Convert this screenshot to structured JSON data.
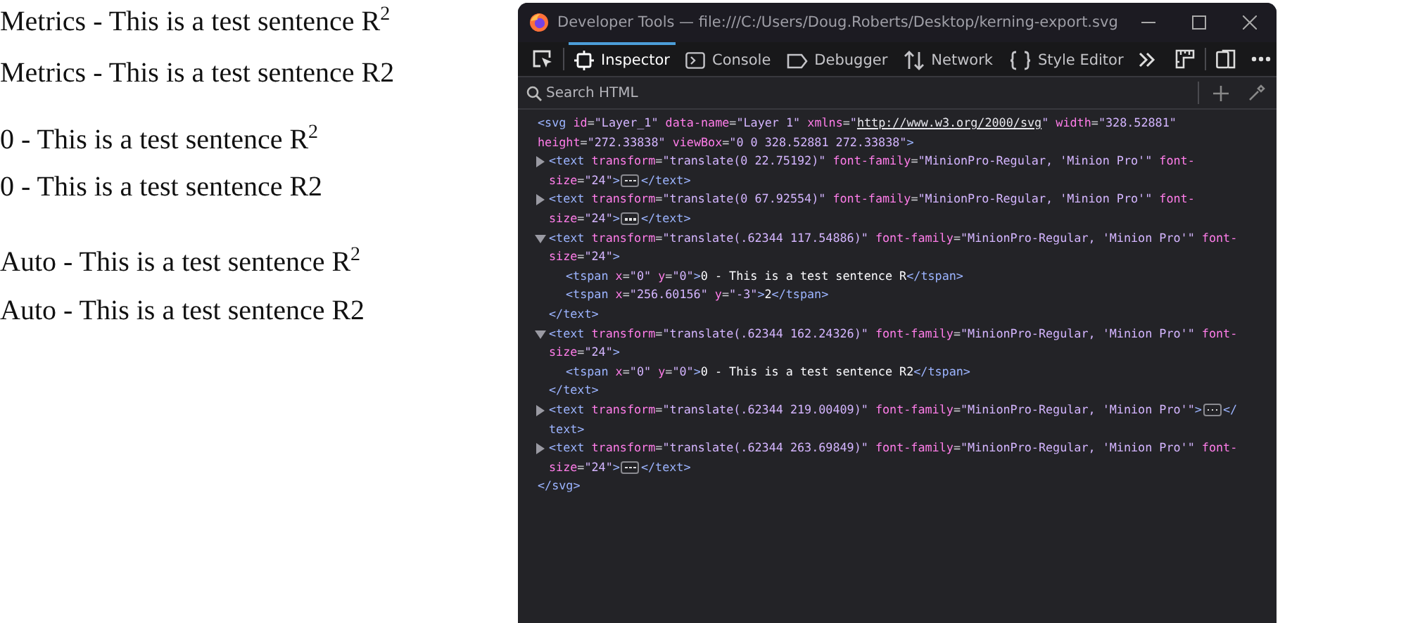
{
  "sentences": [
    "Metrics - This is a test sentence R$^{2}$",
    "Metrics - This is a test sentence R2",
    "0 - This is a test sentence R$^{2}$",
    "0 - This is a test sentence R2",
    "Auto - This is a test sentence R$^{2}$",
    "Auto - This is a test sentence R2"
  ],
  "window": {
    "title": "Developer Tools — file:///C:/Users/Doug.Roberts/Desktop/kerning-export.svg"
  },
  "tabs": [
    {
      "label": "Inspector",
      "selected": true
    },
    {
      "label": "Console",
      "selected": false
    },
    {
      "label": "Debugger",
      "selected": false
    },
    {
      "label": "Network",
      "selected": false
    },
    {
      "label": "Style Editor",
      "selected": false
    }
  ],
  "search": {
    "placeholder": "Search HTML"
  },
  "markup": {
    "open": [
      [
        {
          "kind": "tag",
          "text": "<svg"
        },
        {
          "kind": "attr",
          "text": " id"
        },
        {
          "kind": "pun",
          "text": "="
        },
        {
          "kind": "val",
          "text": "\"Layer_1\""
        },
        {
          "kind": "attr",
          "text": " data-name"
        },
        {
          "kind": "pun",
          "text": "="
        },
        {
          "kind": "val",
          "text": "\"Layer 1\""
        },
        {
          "kind": "attr",
          "text": " xmlns"
        },
        {
          "kind": "pun",
          "text": "="
        },
        {
          "kind": "val",
          "text": "\""
        },
        {
          "kind": "link",
          "text": "http://www.w3.org/2000/svg"
        },
        {
          "kind": "val",
          "text": "\""
        },
        {
          "kind": "attr",
          "text": " width"
        },
        {
          "kind": "pun",
          "text": "="
        },
        {
          "kind": "val",
          "text": "\"328.52881\""
        }
      ],
      [
        {
          "kind": "attr",
          "text": "height"
        },
        {
          "kind": "pun",
          "text": "="
        },
        {
          "kind": "val",
          "text": "\"272.33838\""
        },
        {
          "kind": "attr",
          "text": " viewBox"
        },
        {
          "kind": "pun",
          "text": "="
        },
        {
          "kind": "val",
          "text": "\"0 0 328.52881 272.33838\""
        },
        {
          "kind": "tag",
          "text": ">"
        }
      ]
    ],
    "nodes": [
      {
        "expanded": false,
        "open": [
          [
            {
              "kind": "tag",
              "text": "<text"
            },
            {
              "kind": "attr",
              "text": " transform"
            },
            {
              "kind": "pun",
              "text": "="
            },
            {
              "kind": "val",
              "text": "\"translate(0 22.75192)\""
            },
            {
              "kind": "attr",
              "text": " font-family"
            },
            {
              "kind": "pun",
              "text": "="
            },
            {
              "kind": "val",
              "text": "\"MinionPro-Regular, 'Minion Pro'\""
            },
            {
              "kind": "attr",
              "text": " font-"
            }
          ],
          [
            {
              "kind": "attr",
              "text": "size"
            },
            {
              "kind": "pun",
              "text": "="
            },
            {
              "kind": "val",
              "text": "\"24\""
            },
            {
              "kind": "tag",
              "text": ">"
            },
            {
              "kind": "more"
            },
            {
              "kind": "tag",
              "text": "</text>"
            }
          ]
        ]
      },
      {
        "expanded": false,
        "open": [
          [
            {
              "kind": "tag",
              "text": "<text"
            },
            {
              "kind": "attr",
              "text": " transform"
            },
            {
              "kind": "pun",
              "text": "="
            },
            {
              "kind": "val",
              "text": "\"translate(0 67.92554)\""
            },
            {
              "kind": "attr",
              "text": " font-family"
            },
            {
              "kind": "pun",
              "text": "="
            },
            {
              "kind": "val",
              "text": "\"MinionPro-Regular, 'Minion Pro'\""
            },
            {
              "kind": "attr",
              "text": " font-"
            }
          ],
          [
            {
              "kind": "attr",
              "text": "size"
            },
            {
              "kind": "pun",
              "text": "="
            },
            {
              "kind": "val",
              "text": "\"24\""
            },
            {
              "kind": "tag",
              "text": ">"
            },
            {
              "kind": "more"
            },
            {
              "kind": "tag",
              "text": "</text>"
            }
          ]
        ]
      },
      {
        "expanded": true,
        "open": [
          [
            {
              "kind": "tag",
              "text": "<text"
            },
            {
              "kind": "attr",
              "text": " transform"
            },
            {
              "kind": "pun",
              "text": "="
            },
            {
              "kind": "val",
              "text": "\"translate(.62344 117.54886)\""
            },
            {
              "kind": "attr",
              "text": " font-family"
            },
            {
              "kind": "pun",
              "text": "="
            },
            {
              "kind": "val",
              "text": "\"MinionPro-Regular, 'Minion Pro'\""
            },
            {
              "kind": "attr",
              "text": " font-"
            }
          ],
          [
            {
              "kind": "attr",
              "text": "size"
            },
            {
              "kind": "pun",
              "text": "="
            },
            {
              "kind": "val",
              "text": "\"24\""
            },
            {
              "kind": "tag",
              "text": ">"
            }
          ]
        ],
        "children": [
          [
            {
              "kind": "tag",
              "text": "<tspan"
            },
            {
              "kind": "attr",
              "text": " x"
            },
            {
              "kind": "pun",
              "text": "="
            },
            {
              "kind": "val",
              "text": "\"0\""
            },
            {
              "kind": "attr",
              "text": " y"
            },
            {
              "kind": "pun",
              "text": "="
            },
            {
              "kind": "val",
              "text": "\"0\""
            },
            {
              "kind": "tag",
              "text": ">"
            },
            {
              "kind": "text",
              "text": "0 - This is a test sentence R"
            },
            {
              "kind": "tag",
              "text": "</tspan>"
            }
          ],
          [
            {
              "kind": "tag",
              "text": "<tspan"
            },
            {
              "kind": "attr",
              "text": " x"
            },
            {
              "kind": "pun",
              "text": "="
            },
            {
              "kind": "val",
              "text": "\"256.60156\""
            },
            {
              "kind": "attr",
              "text": " y"
            },
            {
              "kind": "pun",
              "text": "="
            },
            {
              "kind": "val",
              "text": "\"-3\""
            },
            {
              "kind": "tag",
              "text": ">"
            },
            {
              "kind": "text",
              "text": "2"
            },
            {
              "kind": "tag",
              "text": "</tspan>"
            }
          ]
        ],
        "close": [
          {
            "kind": "tag",
            "text": "</text>"
          }
        ]
      },
      {
        "expanded": true,
        "open": [
          [
            {
              "kind": "tag",
              "text": "<text"
            },
            {
              "kind": "attr",
              "text": " transform"
            },
            {
              "kind": "pun",
              "text": "="
            },
            {
              "kind": "val",
              "text": "\"translate(.62344 162.24326)\""
            },
            {
              "kind": "attr",
              "text": " font-family"
            },
            {
              "kind": "pun",
              "text": "="
            },
            {
              "kind": "val",
              "text": "\"MinionPro-Regular, 'Minion Pro'\""
            },
            {
              "kind": "attr",
              "text": " font-"
            }
          ],
          [
            {
              "kind": "attr",
              "text": "size"
            },
            {
              "kind": "pun",
              "text": "="
            },
            {
              "kind": "val",
              "text": "\"24\""
            },
            {
              "kind": "tag",
              "text": ">"
            }
          ]
        ],
        "children": [
          [
            {
              "kind": "tag",
              "text": "<tspan"
            },
            {
              "kind": "attr",
              "text": " x"
            },
            {
              "kind": "pun",
              "text": "="
            },
            {
              "kind": "val",
              "text": "\"0\""
            },
            {
              "kind": "attr",
              "text": " y"
            },
            {
              "kind": "pun",
              "text": "="
            },
            {
              "kind": "val",
              "text": "\"0\""
            },
            {
              "kind": "tag",
              "text": ">"
            },
            {
              "kind": "text",
              "text": "0 - This is a test sentence R2"
            },
            {
              "kind": "tag",
              "text": "</tspan>"
            }
          ]
        ],
        "close": [
          {
            "kind": "tag",
            "text": "</text>"
          }
        ]
      },
      {
        "expanded": false,
        "open": [
          [
            {
              "kind": "tag",
              "text": "<text"
            },
            {
              "kind": "attr",
              "text": " transform"
            },
            {
              "kind": "pun",
              "text": "="
            },
            {
              "kind": "val",
              "text": "\"translate(.62344 219.00409)\""
            },
            {
              "kind": "attr",
              "text": " font-family"
            },
            {
              "kind": "pun",
              "text": "="
            },
            {
              "kind": "val",
              "text": "\"MinionPro-Regular, 'Minion Pro'\""
            },
            {
              "kind": "tag",
              "text": ">"
            },
            {
              "kind": "more"
            },
            {
              "kind": "tag",
              "text": "</"
            }
          ],
          [
            {
              "kind": "tag",
              "text": "text>"
            }
          ]
        ]
      },
      {
        "expanded": false,
        "open": [
          [
            {
              "kind": "tag",
              "text": "<text"
            },
            {
              "kind": "attr",
              "text": " transform"
            },
            {
              "kind": "pun",
              "text": "="
            },
            {
              "kind": "val",
              "text": "\"translate(.62344 263.69849)\""
            },
            {
              "kind": "attr",
              "text": " font-family"
            },
            {
              "kind": "pun",
              "text": "="
            },
            {
              "kind": "val",
              "text": "\"MinionPro-Regular, 'Minion Pro'\""
            },
            {
              "kind": "attr",
              "text": " font-"
            }
          ],
          [
            {
              "kind": "attr",
              "text": "size"
            },
            {
              "kind": "pun",
              "text": "="
            },
            {
              "kind": "val",
              "text": "\"24\""
            },
            {
              "kind": "tag",
              "text": ">"
            },
            {
              "kind": "more"
            },
            {
              "kind": "tag",
              "text": "</text>"
            }
          ]
        ]
      }
    ],
    "close": [
      {
        "kind": "tag",
        "text": "</svg>"
      }
    ]
  }
}
